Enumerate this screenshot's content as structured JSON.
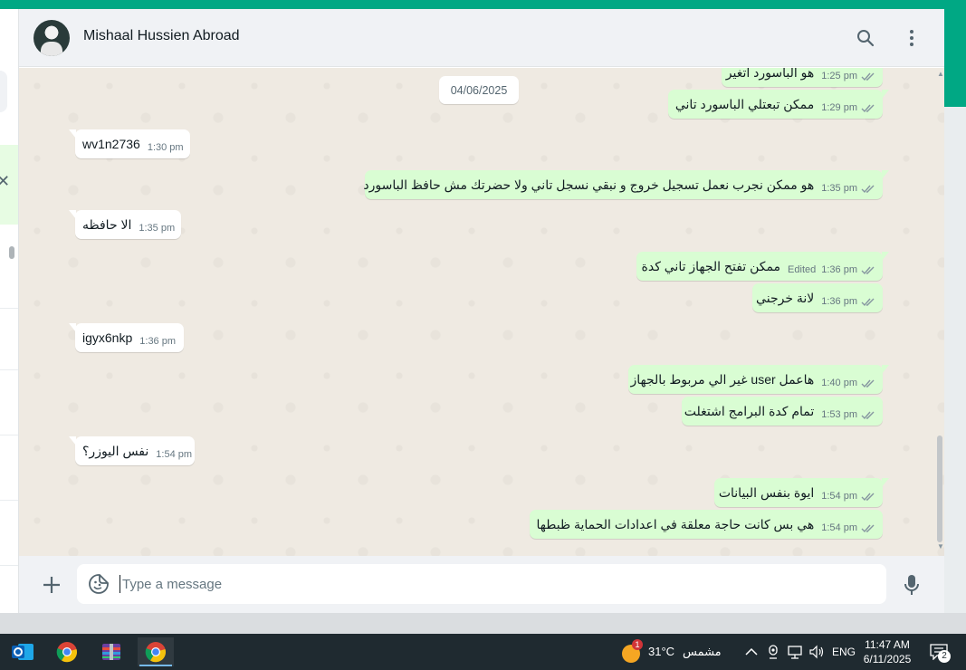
{
  "chat": {
    "contact_name": "Mishaal Hussien Abroad",
    "date_separator": "04/06/2025",
    "messages": [
      {
        "dir": "out",
        "text": "هو الباسورد اتغير",
        "time": "1:25 pm",
        "edited": ""
      },
      {
        "dir": "out",
        "text": "ممكن تبعتلي الباسورد تاني",
        "time": "1:29 pm",
        "edited": ""
      },
      {
        "dir": "in",
        "text": "wv1n2736",
        "time": "1:30 pm",
        "edited": ""
      },
      {
        "dir": "out",
        "text": "هو ممكن نجرب نعمل تسجيل خروج و نبقي نسجل تاني ولا حضرتك مش حافظ الباسورد",
        "time": "1:35 pm",
        "edited": ""
      },
      {
        "dir": "in",
        "text": "الا حافظه",
        "time": "1:35 pm",
        "edited": ""
      },
      {
        "dir": "out",
        "text": "ممكن تفتح الجهاز تاني كدة",
        "time": "1:36 pm",
        "edited": "Edited"
      },
      {
        "dir": "out",
        "text": "لانة خرجني",
        "time": "1:36 pm",
        "edited": ""
      },
      {
        "dir": "in",
        "text": "igyx6nkp",
        "time": "1:36 pm",
        "edited": ""
      },
      {
        "dir": "out",
        "text": "هاعمل user غير الي مربوط بالجهاز",
        "time": "1:40 pm",
        "edited": ""
      },
      {
        "dir": "out",
        "text": "تمام كدة البرامج اشتغلت",
        "time": "1:53 pm",
        "edited": ""
      },
      {
        "dir": "in",
        "text": "نفس اليوزر؟",
        "time": "1:54 pm",
        "edited": ""
      },
      {
        "dir": "out",
        "text": "ايوة بنفس البيانات",
        "time": "1:54 pm",
        "edited": ""
      },
      {
        "dir": "out",
        "text": "هي بس كانت حاجة معلقة في اعدادات الحماية ظبطها",
        "time": "1:54 pm",
        "edited": ""
      }
    ]
  },
  "composer": {
    "placeholder": "Type a message",
    "value": ""
  },
  "icons": {
    "search": "search-icon",
    "menu": "kebab-menu-icon",
    "attach": "plus-icon",
    "emoji": "sticker-icon",
    "mic": "microphone-icon",
    "read_receipt": "double-check-icon"
  },
  "taskbar": {
    "apps": [
      "outlook-icon",
      "chrome-icon",
      "winrar-icon",
      "chrome-icon"
    ],
    "weather_badge": "1",
    "weather_temp": "31°C",
    "weather_desc": "مشمس",
    "language": "ENG",
    "time": "11:47 AM",
    "date": "6/11/2025",
    "notifications": "2"
  },
  "colors": {
    "accent": "#00a884",
    "outgoing_bubble": "#d9fdd3",
    "incoming_bubble": "#ffffff",
    "chat_background": "#efeae2",
    "header_background": "#f0f2f5",
    "taskbar": "#1f2a30"
  }
}
